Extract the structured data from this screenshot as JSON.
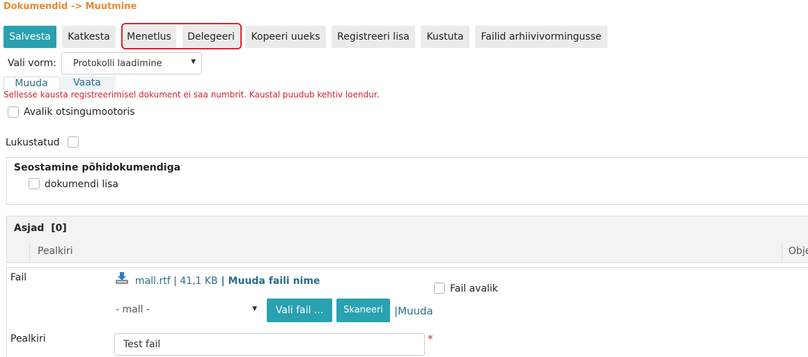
{
  "breadcrumb": "Dokumendid -> Muutmine",
  "toolbar": {
    "save": "Salvesta",
    "cancel": "Katkesta",
    "process": "Menetlus",
    "delegate": "Delegeeri",
    "copy": "Kopeeri uueks",
    "register_attachment": "Registreeri lisa",
    "delete": "Kustuta",
    "archive": "Failid arhiivivormingusse"
  },
  "form_select": {
    "label": "Vali vorm:",
    "value": "Protokolli laadimine"
  },
  "tabs": {
    "edit": "Muuda",
    "view": "Vaata"
  },
  "warning": "Sellesse kausta registreerimisel dokument ei saa numbrit. Kaustal puudub kehtiv loendur.",
  "public_search": "Avalik otsingumootoris",
  "locked": "Lukustatud",
  "linking": {
    "title": "Seostamine põhidokumendiga",
    "checkbox_label": "dokumendi lisa"
  },
  "asjad": {
    "title": "Asjad",
    "count": "[0]",
    "columns": [
      "Pealkiri",
      "Obje"
    ]
  },
  "file": {
    "label": "Fail",
    "name": "mall.rtf",
    "separator1": " | ",
    "size": "41,1 KB",
    "separator2": " | ",
    "rename": "Muuda faili nime",
    "public_label": "Fail avalik",
    "template_value": "- mall -",
    "choose": "Vali fail ...",
    "scan": "Skaneeri",
    "edit_sep": "|",
    "edit": "Muuda"
  },
  "title_field": {
    "label": "Pealkiri",
    "value": "Test fail",
    "required_mark": "*"
  },
  "colors": {
    "accent": "#2aa1b0",
    "breadcrumb": "#e88a2e",
    "warning": "#d9202e",
    "link": "#2a6d8c",
    "highlight_border": "#d9202e"
  }
}
